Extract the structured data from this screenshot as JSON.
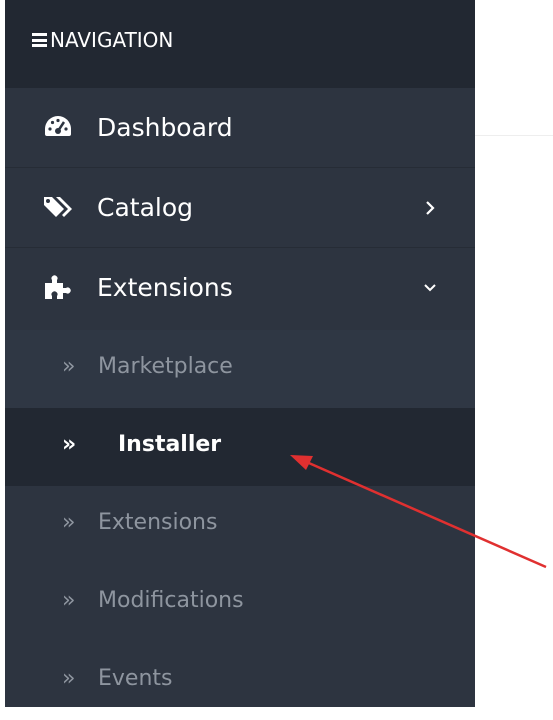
{
  "nav_header": {
    "title": "NAVIGATION",
    "icon": "hamburger-icon"
  },
  "menu": {
    "items": [
      {
        "label": "Dashboard",
        "icon": "dashboard-icon",
        "expand": "none"
      },
      {
        "label": "Catalog",
        "icon": "tags-icon",
        "expand": "chevron-right-icon"
      },
      {
        "label": "Extensions",
        "icon": "puzzle-icon",
        "expand": "chevron-down-icon"
      }
    ],
    "submenu": [
      {
        "arrow": "»",
        "label": "Marketplace"
      },
      {
        "arrow": "»",
        "label": "Installer",
        "active": true
      },
      {
        "arrow": "»",
        "label": "Extensions"
      },
      {
        "arrow": "»",
        "label": "Modifications"
      },
      {
        "arrow": "»",
        "label": "Events"
      }
    ]
  },
  "annotation": {
    "arrow_color": "#e03030",
    "target": "Installer"
  },
  "colors": {
    "sidebar_bg": "#2d3440",
    "header_bg": "#222832",
    "active_bg": "#222832",
    "muted_text": "#8e959f"
  }
}
